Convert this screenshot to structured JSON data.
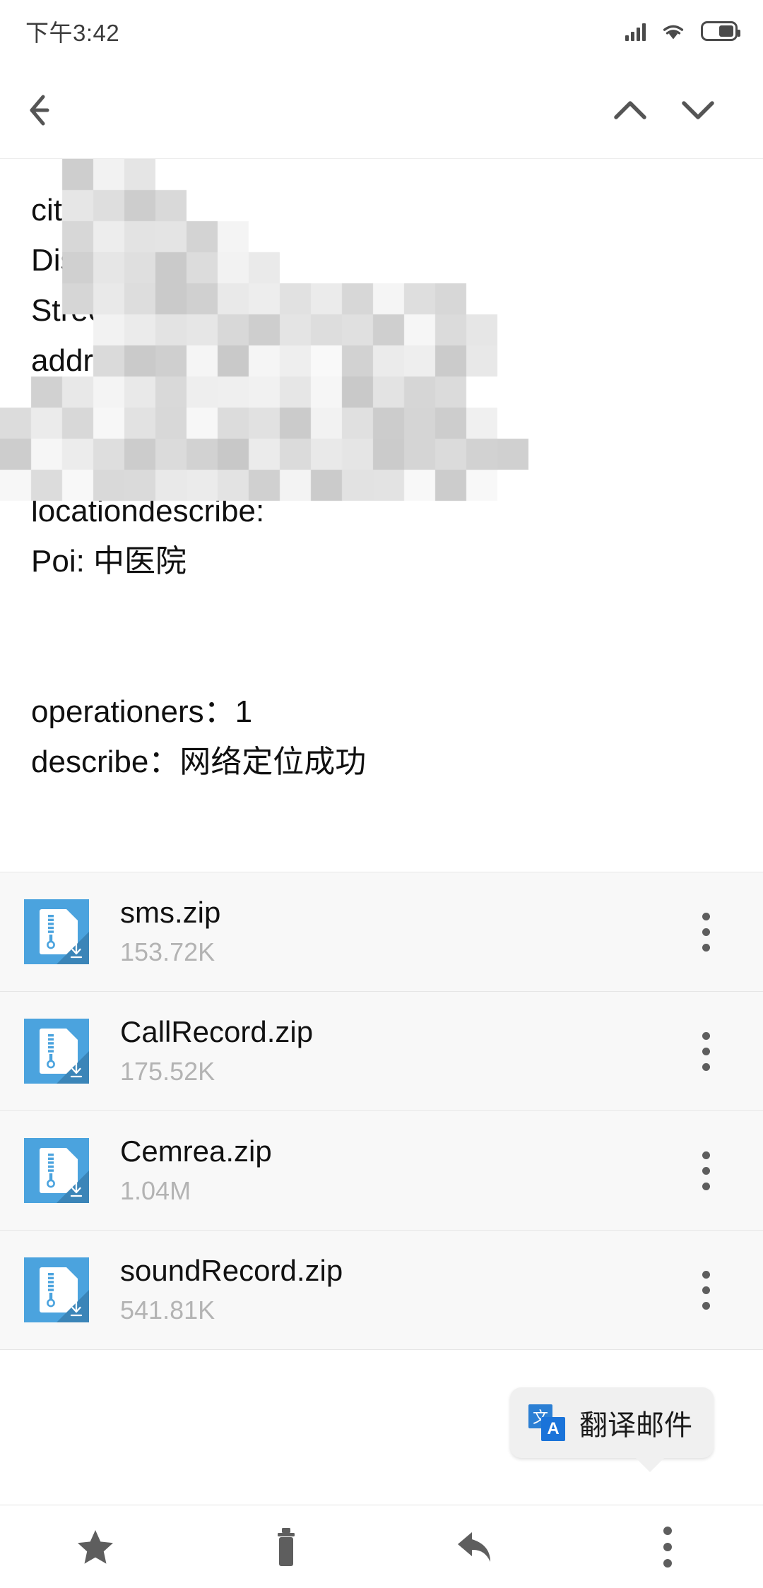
{
  "statusbar": {
    "time": "下午3:42",
    "icons": [
      "signal-icon",
      "wifi-icon",
      "battery-icon"
    ]
  },
  "navbar": {
    "back_icon": "back-arrow-icon",
    "prev_icon": "chevron-up-icon",
    "next_icon": "chevron-down-icon"
  },
  "message_body": {
    "lines": [
      {
        "text": "",
        "clipped": true
      },
      {
        "text": "city"
      },
      {
        "text": "Distr"
      },
      {
        "text": "Street"
      },
      {
        "text": "addr：5"
      },
      {
        "text": "UserIndoorstate：1"
      },
      {
        "text": "Direction(not all devices have va"
      },
      {
        "text": "locationdescribe:"
      },
      {
        "text": "Poi: 中医院"
      },
      {
        "text": ""
      },
      {
        "text": ""
      },
      {
        "text": "operationers：1"
      },
      {
        "text": "describe：网络定位成功"
      }
    ],
    "visible_text": "city / Distr / Street / addr：5 / UserIndoorstate：1 / Direction(not all devices have va / locationdescribe: / Poi: 中医院 / operationers：1 / describe：网络定位成功",
    "redaction": "mosaic-pixelation"
  },
  "attachments": {
    "items": [
      {
        "name": "sms.zip",
        "size": "153.72K",
        "icon": "zip-file-icon",
        "menu_icon": "overflow-menu-icon"
      },
      {
        "name": "CallRecord.zip",
        "size": "175.52K",
        "icon": "zip-file-icon",
        "menu_icon": "overflow-menu-icon"
      },
      {
        "name": "Cemrea.zip",
        "size": "1.04M",
        "icon": "zip-file-icon",
        "menu_icon": "overflow-menu-icon"
      },
      {
        "name": "soundRecord.zip",
        "size": "541.81K",
        "icon": "zip-file-icon",
        "menu_icon": "overflow-menu-icon"
      }
    ]
  },
  "tooltip": {
    "label": "翻译邮件",
    "icon": "translate-icon",
    "icon_glyph_source": "文",
    "icon_glyph_target": "A"
  },
  "toolbar": {
    "buttons": [
      {
        "name": "star-icon"
      },
      {
        "name": "trash-icon"
      },
      {
        "name": "reply-icon"
      },
      {
        "name": "overflow-menu-icon"
      }
    ]
  },
  "colors": {
    "accent_blue": "#4ba3de",
    "accent_blue_dark": "#3b85b8",
    "translate_blue": "#2b7fd4",
    "icon_gray": "#5e5e5e",
    "text_primary": "#111111",
    "text_secondary": "#b3b3b3",
    "list_bg": "#f8f8f8",
    "tooltip_bg": "#f0f0f0"
  }
}
